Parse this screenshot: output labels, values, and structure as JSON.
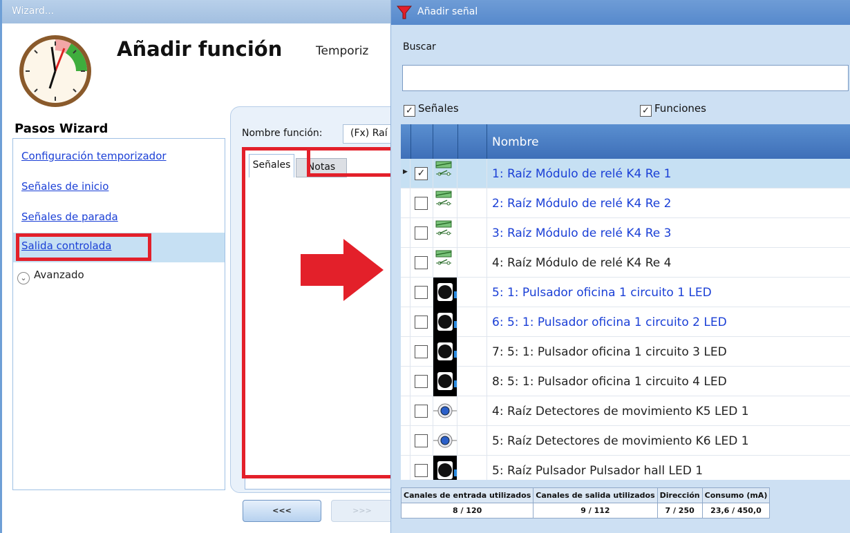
{
  "wizard": {
    "window_title": "Wizard...",
    "title": "Añadir función",
    "subtitle": "Temporiz",
    "steps_heading": "Pasos Wizard",
    "steps": [
      {
        "label": "Configuración temporizador"
      },
      {
        "label": "Señales de inicio"
      },
      {
        "label": "Señales de parada"
      },
      {
        "label": "Salida controlada"
      }
    ],
    "advanced_label": "Avanzado",
    "function_name_label": "Nombre función:",
    "function_name_value": "(Fx) Raí",
    "tabs": [
      {
        "label": "Señales"
      },
      {
        "label": "Notas"
      }
    ],
    "back_label": "<<<",
    "next_label": ">>>",
    "highlight_color": "#e3202a"
  },
  "dialog": {
    "title": "Añadir señal",
    "search_label": "Buscar",
    "search_value": "",
    "filter_signals_label": "Señales",
    "filter_signals_checked": true,
    "filter_functions_label": "Funciones",
    "filter_functions_checked": true,
    "column_name": "Nombre",
    "rows": [
      {
        "name": "1: Raíz Módulo de relé K4 Re 1",
        "icon": "relay-icon",
        "checked": true,
        "current": true,
        "link": true
      },
      {
        "name": "2: Raíz Módulo de relé K4 Re 2",
        "icon": "relay-icon",
        "checked": false,
        "current": false,
        "link": true
      },
      {
        "name": "3: Raíz Módulo de relé K4 Re 3",
        "icon": "relay-icon",
        "checked": false,
        "current": false,
        "link": true
      },
      {
        "name": "4: Raíz Módulo de relé K4 Re 4",
        "icon": "relay-icon",
        "checked": false,
        "current": false,
        "link": false
      },
      {
        "name": "5: 1: Pulsador oficina 1 circuito 1 LED",
        "icon": "pushbutton-icon",
        "checked": false,
        "current": false,
        "link": true
      },
      {
        "name": "6: 5: 1: Pulsador oficina 1 circuito 2 LED",
        "icon": "pushbutton-icon",
        "checked": false,
        "current": false,
        "link": true
      },
      {
        "name": "7: 5: 1: Pulsador oficina 1 circuito 3 LED",
        "icon": "pushbutton-icon",
        "checked": false,
        "current": false,
        "link": false
      },
      {
        "name": "8: 5: 1: Pulsador oficina 1 circuito 4 LED",
        "icon": "pushbutton-icon",
        "checked": false,
        "current": false,
        "link": false
      },
      {
        "name": "4: Raíz Detectores de movimiento K5 LED 1",
        "icon": "motion-detector-icon",
        "checked": false,
        "current": false,
        "link": false
      },
      {
        "name": "5: Raíz Detectores de movimiento K6 LED 1",
        "icon": "motion-detector-icon",
        "checked": false,
        "current": false,
        "link": false
      },
      {
        "name": "5: Raíz Pulsador Pulsador hall LED 1",
        "icon": "pushbutton-icon",
        "checked": false,
        "current": false,
        "link": false
      }
    ],
    "stats": {
      "headers": [
        "Canales de entrada utilizados",
        "Canales de salida utilizados",
        "Dirección",
        "Consumo (mA)"
      ],
      "values": [
        "8 / 120",
        "9 / 112",
        "7 / 250",
        "23,6 / 450,0"
      ]
    },
    "link_color": "#1a3fd6",
    "selected_row_color": "#c6e0f3",
    "header_color": "#4a7ec4"
  }
}
